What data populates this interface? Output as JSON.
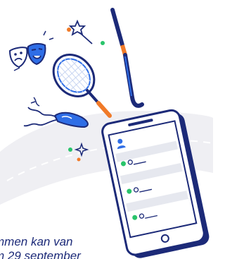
{
  "caption": {
    "line1": "mmen kan van",
    "line2": "m 29 september"
  },
  "colors": {
    "navy": "#1c2a78",
    "blue": "#2f6ee6",
    "orange": "#f07a28",
    "green": "#29c46b",
    "road": "#efeff3",
    "screen_row": "#e6e8ef"
  },
  "icons": [
    "theater-masks-icon",
    "tennis-racket-icon",
    "hockey-stick-icon",
    "ballet-shoe-icon",
    "star-wand-icon",
    "sparkle-icon",
    "smartphone-icon",
    "user-icon"
  ]
}
